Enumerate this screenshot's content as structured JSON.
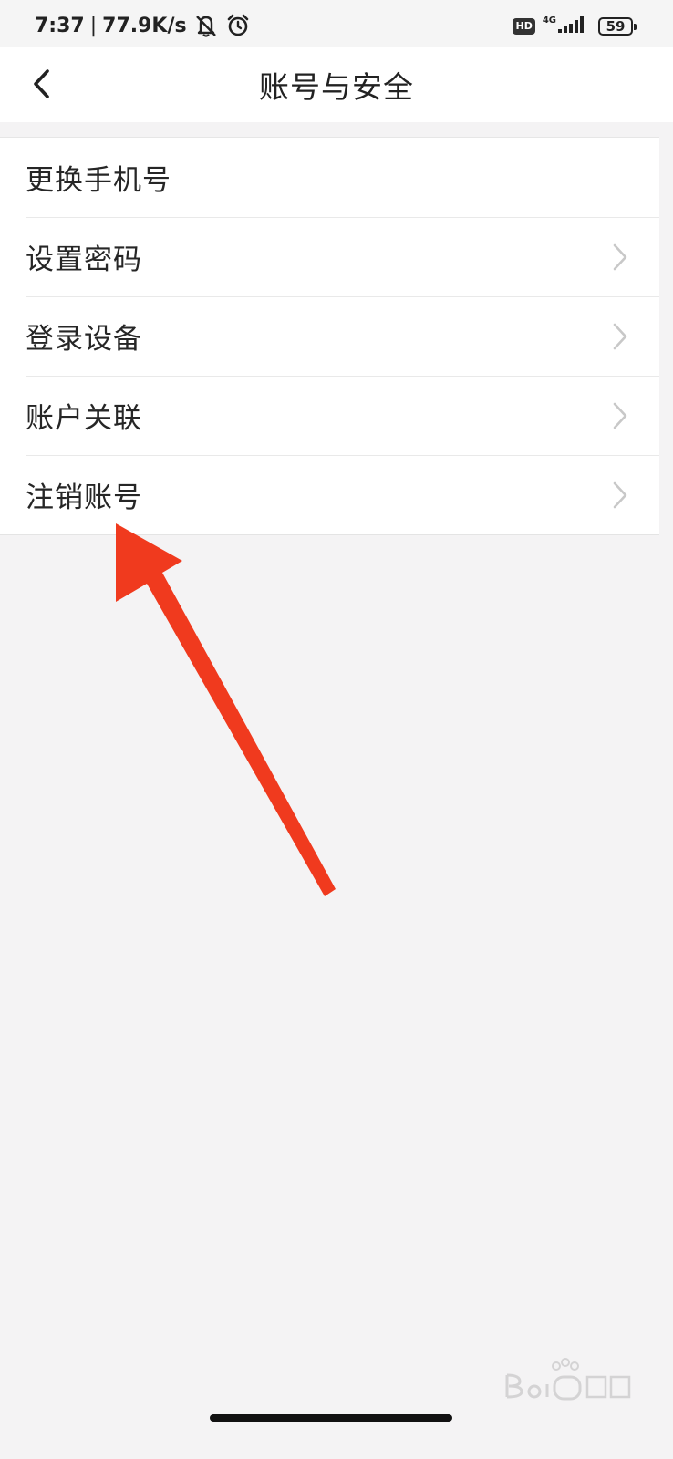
{
  "status_bar": {
    "time": "7:37",
    "separator": "|",
    "net_speed": "77.9K/s",
    "left_icons": [
      "bell-muted-icon",
      "alarm-icon"
    ],
    "hd_label": "HD",
    "network_type": "4G",
    "battery": "59"
  },
  "nav": {
    "back_icon": "chevron-left-icon",
    "title": "账号与安全"
  },
  "settings": {
    "items": [
      {
        "label": "更换手机号",
        "has_chevron": false
      },
      {
        "label": "设置密码",
        "has_chevron": true
      },
      {
        "label": "登录设备",
        "has_chevron": true
      },
      {
        "label": "账户关联",
        "has_chevron": true
      },
      {
        "label": "注销账号",
        "has_chevron": true
      }
    ]
  },
  "annotation": {
    "type": "arrow",
    "color": "#f03a1e",
    "points_to": "注销账号"
  },
  "colors": {
    "background": "#f4f3f4",
    "surface": "#ffffff",
    "text": "#222222",
    "chevron": "#c8c8c8",
    "arrow": "#f03a1e"
  }
}
